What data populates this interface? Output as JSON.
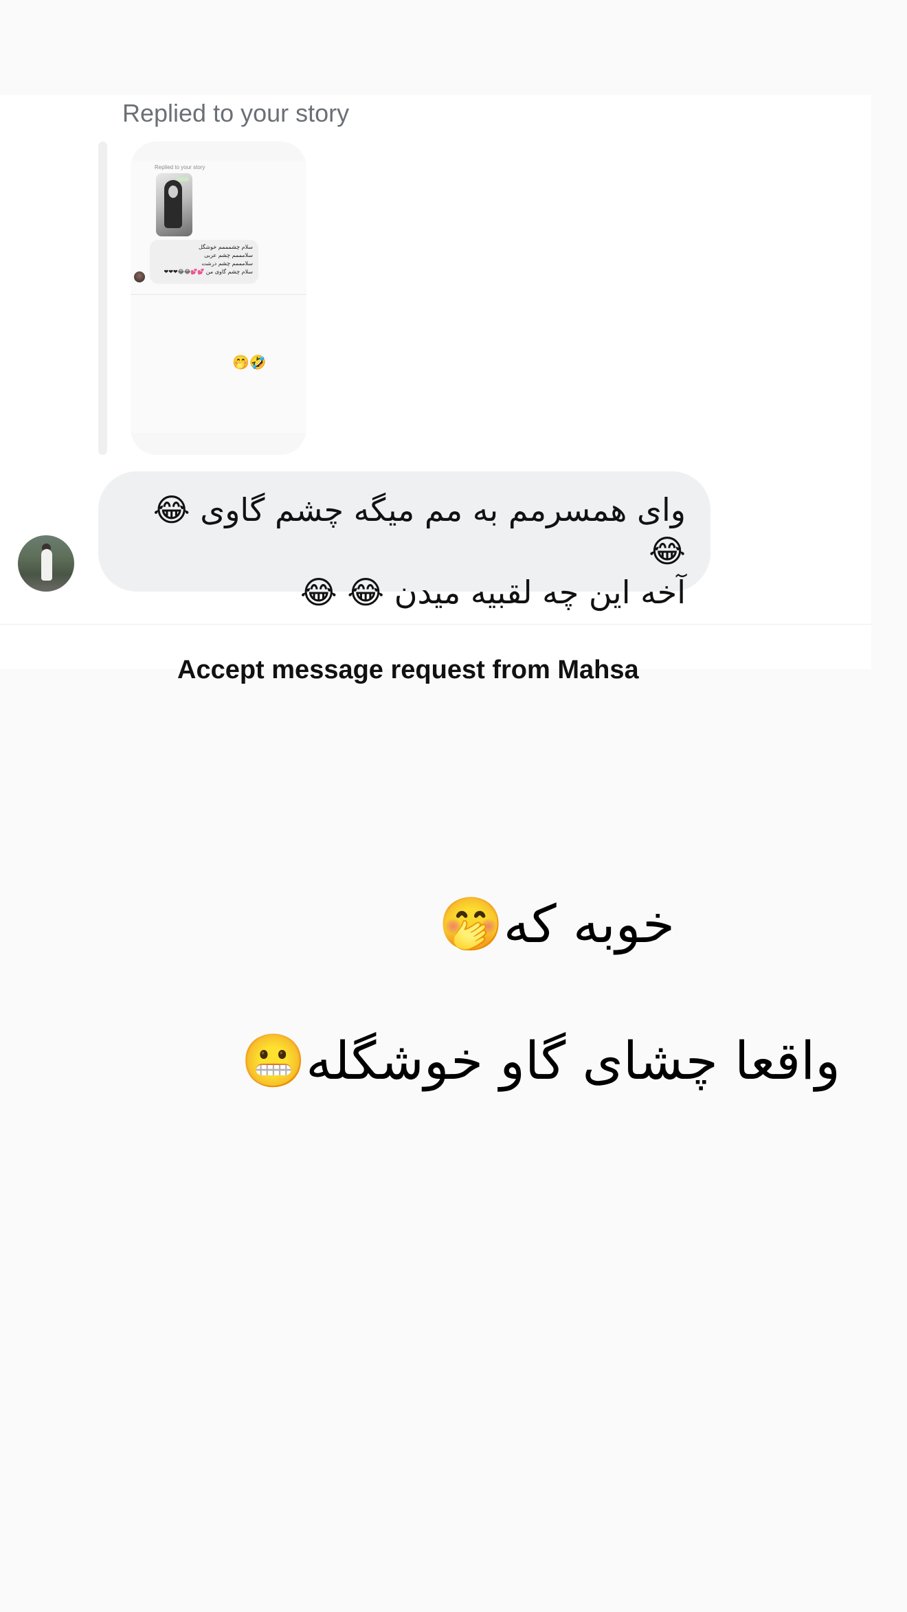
{
  "conversation": {
    "reply_label": "Replied to your story",
    "story_preview": {
      "reply_label": "Replied to your story",
      "bubble_lines": [
        "سلام چشمممم خوشگل",
        "سلامممم چشم عربی",
        "سلامممم چشم درشت",
        "سلام چشم گاوی من 💕💕😂😂❤❤❤"
      ],
      "reaction_emoji": "🤭🤣"
    },
    "message": {
      "line1": "وای همسرمم به مم میگه چشم گاوی 😂 😂",
      "line2": "آخه این چه لقبیه میدن 😂 😂"
    },
    "accept_request": "Accept message request from Mahsa"
  },
  "overlay_text": {
    "line1": "خوبه که🤭",
    "line2": "واقعا چشای گاو خوشگله😬"
  }
}
